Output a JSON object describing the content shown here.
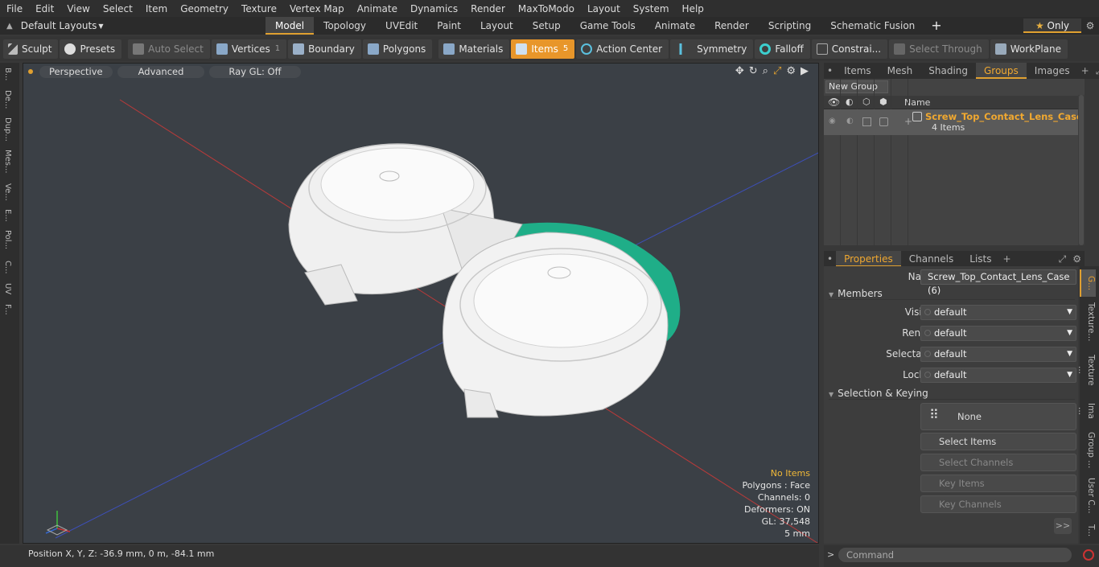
{
  "menu": [
    "File",
    "Edit",
    "View",
    "Select",
    "Item",
    "Geometry",
    "Texture",
    "Vertex Map",
    "Animate",
    "Dynamics",
    "Render",
    "MaxToModo",
    "Layout",
    "System",
    "Help"
  ],
  "layouts_label": "Default Layouts",
  "tabs": [
    "Model",
    "Topology",
    "UVEdit",
    "Paint",
    "Layout",
    "Setup",
    "Game Tools",
    "Animate",
    "Render",
    "Scripting",
    "Schematic Fusion"
  ],
  "only_label": "Only",
  "toolbar": {
    "sculpt": "Sculpt",
    "presets": "Presets",
    "auto_select": "Auto Select",
    "vertices": "Vertices",
    "vertices_count": "1",
    "boundary": "Boundary",
    "polygons": "Polygons",
    "materials": "Materials",
    "items": "Items",
    "items_count": "5",
    "action_center": "Action Center",
    "symmetry": "Symmetry",
    "falloff": "Falloff",
    "constraints": "Constrai...",
    "select_through": "Select Through",
    "workplane": "WorkPlane"
  },
  "left_tabs": [
    "B...",
    "De...",
    "Dup...",
    "Mes...",
    "Ve...",
    "E...",
    "Pol...",
    "C...",
    "UV",
    "F..."
  ],
  "viewport": {
    "view_mode": "Perspective",
    "shading": "Advanced",
    "raygl": "Ray GL: Off",
    "hud": {
      "items": "No Items",
      "polygons": "Polygons : Face",
      "channels": "Channels: 0",
      "deformers": "Deformers: ON",
      "gl": "GL: 37,548",
      "scale": "5 mm"
    }
  },
  "status": {
    "position": "Position X, Y, Z:   -36.9 mm, 0 m, -84.1 mm"
  },
  "right_tabs": [
    "Items",
    "Mesh ...",
    "Shading",
    "Groups",
    "Images"
  ],
  "groups": {
    "new_group": "New Group",
    "col_name": "Name",
    "row_name": "Screw_Top_Contact_Lens_Case",
    "row_sub": "4 Items"
  },
  "prop_tabs": [
    "Properties",
    "Channels",
    "Lists"
  ],
  "properties": {
    "name_label": "Name",
    "name_value": "Screw_Top_Contact_Lens_Case (6)",
    "members": "Members",
    "fields": [
      {
        "label": "Visible",
        "value": "default"
      },
      {
        "label": "Render",
        "value": "default"
      },
      {
        "label": "Selectable",
        "value": "default"
      },
      {
        "label": "Locked",
        "value": "default"
      }
    ],
    "sel_key": "Selection & Keying",
    "none": "None",
    "select_items": "Select Items",
    "select_channels": "Select Channels",
    "key_items": "Key Items",
    "key_channels": "Key Channels",
    "more": ">>"
  },
  "side_tabs": [
    "G...",
    "Texture...",
    "Texture ...",
    "Ima ...",
    "Group ...",
    "User C...",
    "T..."
  ],
  "command_placeholder": "Command",
  "colors": {
    "accent": "#e0a030",
    "viewport_bg": "#3b4046",
    "green": "#1fae88"
  }
}
